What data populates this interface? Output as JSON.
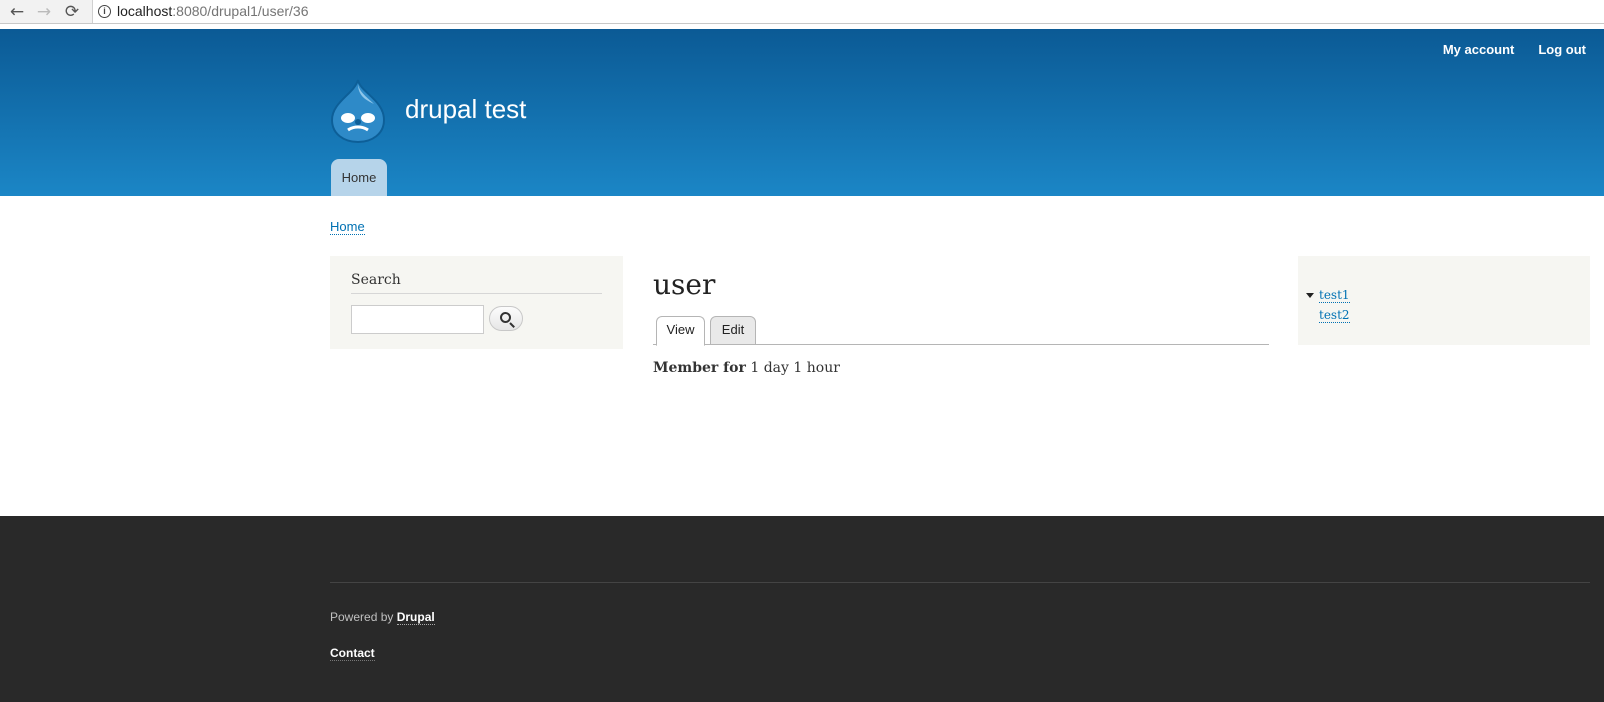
{
  "browser": {
    "back_icon": "←",
    "forward_icon": "→",
    "reload_icon": "⟳",
    "info_icon": "i",
    "url_host": "localhost",
    "url_rest": ":8080/drupal1/user/36"
  },
  "header": {
    "secondary_menu": [
      "My account",
      "Log out"
    ],
    "site_name": "drupal test",
    "main_menu": [
      "Home"
    ]
  },
  "breadcrumb": "Home",
  "search_block": {
    "title": "Search",
    "input_value": "",
    "button_icon": "search-icon"
  },
  "content": {
    "title": "user",
    "tabs": [
      "View",
      "Edit"
    ],
    "member_for_label": "Member for",
    "member_for_value": "1 day 1 hour"
  },
  "sidebar_second": {
    "links": [
      "test1",
      "test2"
    ]
  },
  "footer": {
    "powered_by_text": "Powered by",
    "powered_by_link": "Drupal",
    "contact": "Contact"
  },
  "colors": {
    "header_top": "#0b5a95",
    "header_bottom": "#1b86c6",
    "link": "#0071b3",
    "footer_bg": "#292929",
    "sidebar_bg": "#f6f6f2"
  }
}
